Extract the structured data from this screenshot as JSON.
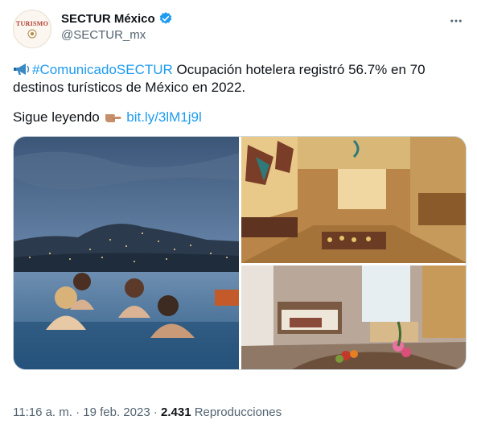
{
  "account": {
    "display_name": "SECTUR México",
    "handle": "@SECTUR_mx",
    "avatar_text": "TURISMO",
    "verified_icon": "verified-badge-icon",
    "more_icon": "more-dots-icon"
  },
  "tweet": {
    "megaphone_emoji": "megaphone-icon",
    "hashtag": "#ComunicadoSECTUR",
    "text_line1_rest": " Ocupación hotelera registró 56.7% en 70",
    "text_line2": "destinos turísticos de México en 2022.",
    "read_more": "Sigue leyendo",
    "pointing_emoji": "pointing-hand-icon",
    "link": "bit.ly/3lM1j9l"
  },
  "media": {
    "photos": [
      {
        "name": "infinity-pool-night-photo"
      },
      {
        "name": "hotel-restaurant-buffet-photo"
      },
      {
        "name": "hotel-room-photo"
      }
    ]
  },
  "meta": {
    "time_date": "11:16 a. m. · 19 feb. 2023 · ",
    "views_count": "2.431",
    "views_label": " Reproducciones"
  },
  "colors": {
    "accent": "#1d9bf0",
    "text": "#0f1419",
    "secondary": "#536471"
  }
}
